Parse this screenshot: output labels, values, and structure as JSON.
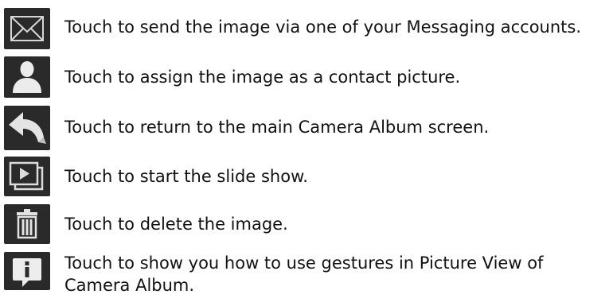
{
  "rows": [
    {
      "icon": "envelope-icon",
      "text": "Touch to send the image via one of your Messaging accounts."
    },
    {
      "icon": "contact-person-icon",
      "text": "Touch to assign the image as a contact picture."
    },
    {
      "icon": "back-arrow-icon",
      "text": "Touch to return to the main Camera Album screen."
    },
    {
      "icon": "slideshow-icon",
      "text": "Touch to start the slide show."
    },
    {
      "icon": "trash-icon",
      "text": "Touch to delete the image."
    },
    {
      "icon": "info-icon",
      "text": "Touch to show you how to use gestures in Picture View of Camera Album."
    }
  ]
}
